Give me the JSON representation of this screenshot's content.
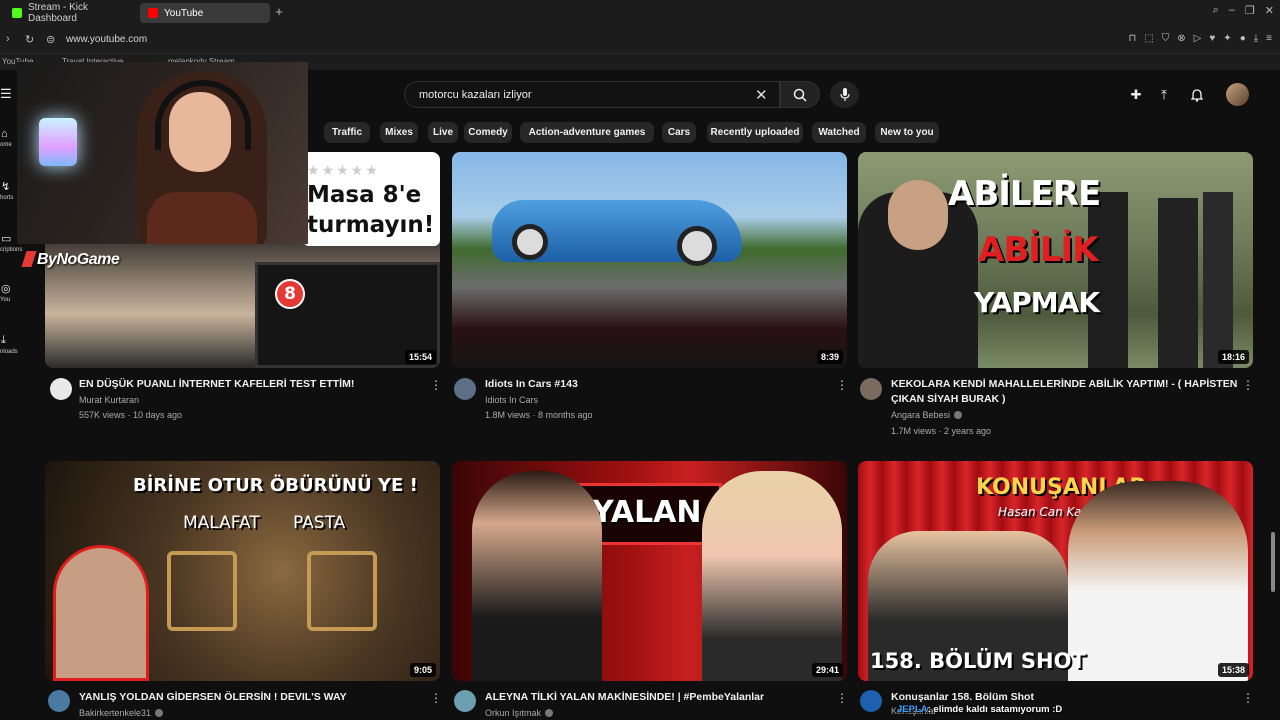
{
  "browser": {
    "tabs": [
      {
        "title": "Stream - Kick Dashboard",
        "favicon_color": "#53fc18"
      },
      {
        "title": "YouTube",
        "favicon_color": "#ff0000"
      }
    ],
    "url": "www.youtube.com",
    "bookmarks": [
      "YouTube",
      "Trayat Interactive",
      "melankody Stream"
    ]
  },
  "search": {
    "query": "motorcu kazaları izliyor"
  },
  "chips": [
    "Traffic",
    "Mixes",
    "Live",
    "Comedy",
    "Action-adventure games",
    "Cars",
    "Recently uploaded",
    "Watched",
    "New to you"
  ],
  "sidebar": [
    {
      "icon": "home-icon",
      "label": "ome"
    },
    {
      "icon": "shorts-icon",
      "label": "horts"
    },
    {
      "icon": "subscriptions-icon",
      "label": "criptions"
    },
    {
      "icon": "you-icon",
      "label": "You"
    },
    {
      "icon": "downloads-icon",
      "label": "nloads"
    }
  ],
  "overlay": {
    "brand": "ByNoGame",
    "chat_user": "JEPLA",
    "chat_message": ": elimde kaldı satamıyorum :D"
  },
  "videos": [
    {
      "title_lines": [
        "EN DÜŞÜK PUANLI İNTERNET KAFELERİ TEST ETTİM!"
      ],
      "channel": "Murat Kurtaran",
      "verified": false,
      "meta": "557K views · 10 days ago",
      "duration": "15:54",
      "thumb_text": [
        "Masa 8'e",
        "turmayın!",
        "8"
      ],
      "thumb_colors": [
        "#2b2b2b",
        "#d9c7b3"
      ],
      "avatar_color": "#e8e8e8"
    },
    {
      "title_lines": [
        "Idiots In Cars #143"
      ],
      "channel": "Idiots In Cars",
      "verified": false,
      "meta": "1.8M views · 8 months ago",
      "duration": "8:39",
      "thumb_text": [],
      "thumb_colors": [
        "#7fb0e0",
        "#4f6f3c"
      ],
      "avatar_color": "#5d6f86"
    },
    {
      "title_lines": [
        "KEKOLARA KENDİ MAHALLELERİNDE ABİLİK YAPTIM! - ( HAPİSTEN",
        "ÇIKAN SİYAH BURAK )"
      ],
      "channel": "Angara Bebesi",
      "verified": true,
      "meta": "1.7M views · 2 years ago",
      "duration": "18:16",
      "thumb_text": [
        "ABİLERE",
        "ABİLİK",
        "YAPMAK"
      ],
      "thumb_colors": [
        "#6e7a5a",
        "#a7b08c"
      ],
      "avatar_color": "#7a6a60"
    },
    {
      "title_lines": [
        "YANLIŞ YOLDAN GİDERSEN ÖLERSİN ! DEVIL'S WAY"
      ],
      "channel": "Bakirkertenkele31",
      "verified": true,
      "meta": "",
      "duration": "9:05",
      "thumb_text": [
        "BİRİNE OTUR ÖBÜRÜNÜ YE !",
        "MALAFAT",
        "PASTA"
      ],
      "thumb_colors": [
        "#3a2a1a",
        "#6b5030"
      ],
      "avatar_color": "#4a7aa0"
    },
    {
      "title_lines": [
        "ALEYNA TİLKİ YALAN MAKİNESİNDE! | #PembeYalanlar"
      ],
      "channel": "Orkun Işıtmak",
      "verified": true,
      "meta": "",
      "duration": "29:41",
      "thumb_text": [
        "YALAN"
      ],
      "thumb_colors": [
        "#5a0a0a",
        "#c41010"
      ],
      "avatar_color": "#6aa0b0"
    },
    {
      "title_lines": [
        "Konuşanlar 158. Bölüm Shot"
      ],
      "channel": "Konuşanlar",
      "verified": false,
      "meta": "",
      "duration": "15:38",
      "thumb_text": [
        "KONUŞANLAR",
        "Hasan Can Kaya",
        "158. BÖLÜM SHOT"
      ],
      "thumb_colors": [
        "#8a0d10",
        "#d8272b"
      ],
      "avatar_color": "#1e5fae"
    }
  ]
}
